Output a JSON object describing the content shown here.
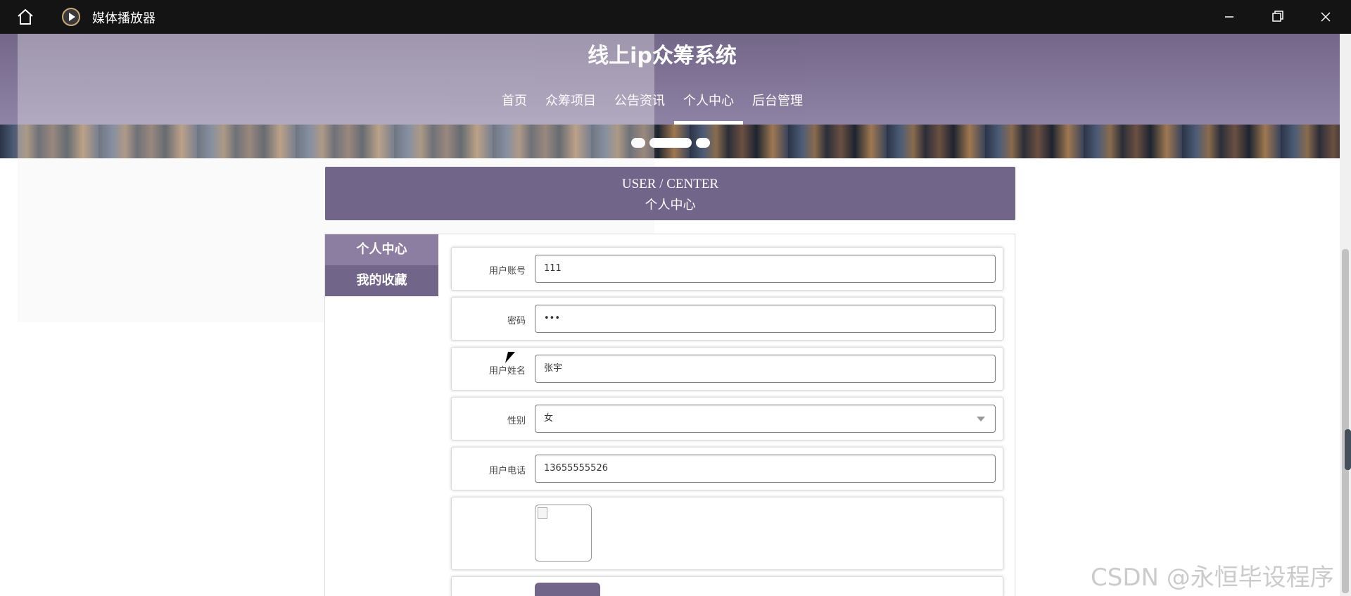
{
  "titlebar": {
    "app_title": "媒体播放器"
  },
  "header": {
    "site_title": "线上ip众筹系统",
    "nav": [
      "首页",
      "众筹项目",
      "公告资讯",
      "个人中心",
      "后台管理"
    ],
    "active_nav": "个人中心"
  },
  "center_head": {
    "en": "USER / CENTER",
    "zh": "个人中心"
  },
  "sidebar": {
    "items": [
      "个人中心",
      "我的收藏"
    ]
  },
  "form": {
    "account_label": "用户账号",
    "account_value": "111",
    "password_label": "密码",
    "password_value": "•••",
    "name_label": "用户姓名",
    "name_value": "张宇",
    "gender_label": "性别",
    "gender_value": "女",
    "phone_label": "用户电话",
    "phone_value": "13655555526"
  },
  "watermark": "CSDN @永恒毕设程序",
  "colors": {
    "accent": "#716589",
    "titlebar": "#141414"
  }
}
